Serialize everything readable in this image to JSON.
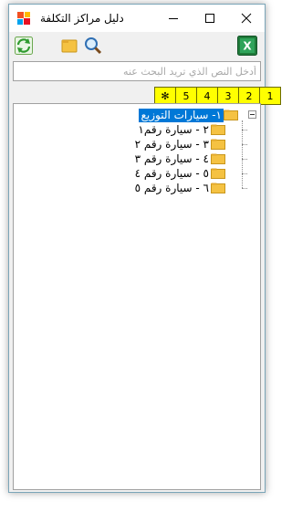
{
  "window": {
    "title": "دليل مراكز التكلفة"
  },
  "toolbar": {
    "refresh_icon": "refresh-icon",
    "folder_icon": "folder-icon",
    "search_icon": "magnifier-icon",
    "excel_icon": "excel-icon"
  },
  "search": {
    "placeholder": "أدخل النص الذي تريد البحث عنه",
    "value": ""
  },
  "levels": [
    "1",
    "2",
    "3",
    "4",
    "5",
    "✻"
  ],
  "tree": {
    "root": {
      "label": "١- سيارات التوزيع",
      "selected": true,
      "expanded": true
    },
    "children": [
      {
        "label": "٢ - سيارة رقم١"
      },
      {
        "label": "٣ - سيارة رقم ٢"
      },
      {
        "label": "٤ - سيارة رقم ٣"
      },
      {
        "label": "٥ - سيارة رقم ٤"
      },
      {
        "label": "٦ - سيارة رقم ٥"
      }
    ]
  },
  "colors": {
    "selection": "#0078d7",
    "level_bg": "#ffff00",
    "folder": "#f5c242"
  }
}
